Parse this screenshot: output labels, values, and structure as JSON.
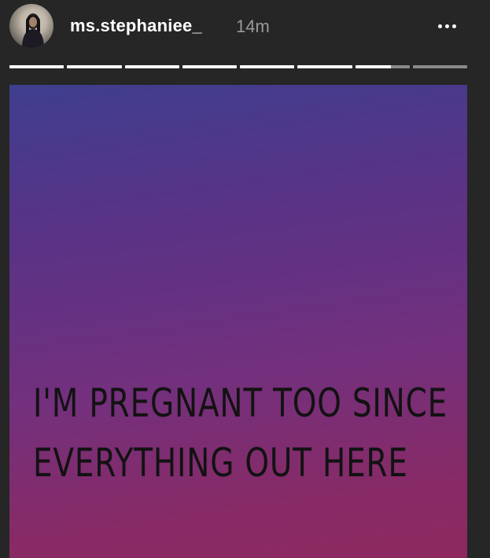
{
  "header": {
    "username": "ms.stephaniee_",
    "timestamp": "14m",
    "avatar_icon": "profile-photo",
    "more_icon": "ellipsis-icon"
  },
  "progress": {
    "segments": [
      1,
      1,
      1,
      1,
      1,
      1,
      0.65,
      0
    ],
    "filled_color": "#ffffff",
    "empty_color": "#8a8a8a"
  },
  "story": {
    "lines": [
      "I'M PREGNANT TOO SINCE",
      "EVERYTHING OUT HERE"
    ],
    "gradient_colors": [
      "#3f3e8e",
      "#5a3286",
      "#73307d",
      "#8e2960"
    ],
    "text_color": "#121212"
  },
  "colors": {
    "background": "#262626",
    "username": "#ffffff",
    "timestamp": "#9a9a9a"
  }
}
